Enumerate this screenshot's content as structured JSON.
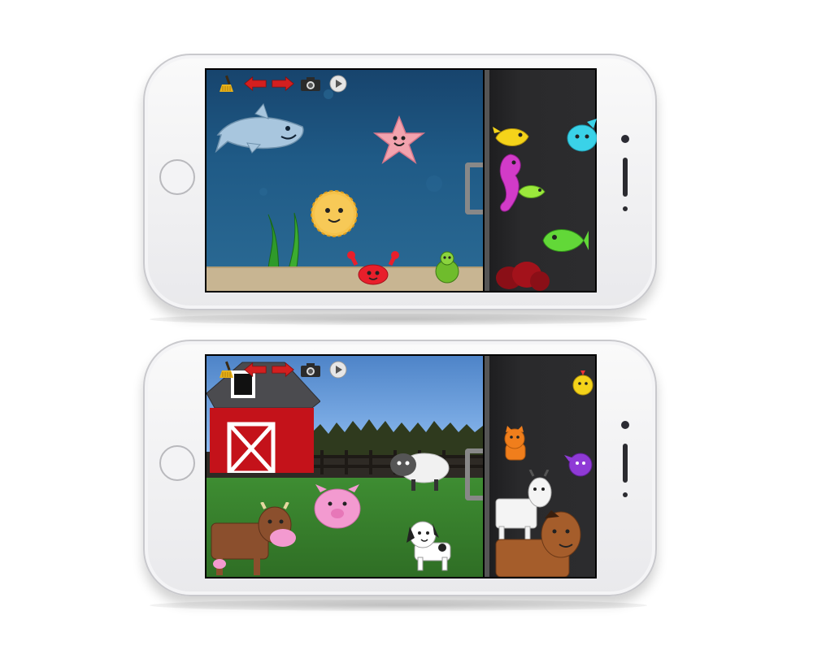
{
  "phones": [
    {
      "id": "ocean",
      "toolbar": {
        "clear_icon": "broom-icon",
        "back_icon": "arrow-left-icon",
        "forward_icon": "arrow-right-icon",
        "camera_icon": "camera-icon",
        "play_icon": "play-icon"
      },
      "scene_stickers": [
        "shark",
        "starfish",
        "pufferfish",
        "seaweed",
        "crab",
        "turtle"
      ],
      "tray_stickers": [
        "yellow-fish",
        "blue-fish",
        "seahorse",
        "green-fish",
        "green-fish-large",
        "coral"
      ]
    },
    {
      "id": "farm",
      "toolbar": {
        "clear_icon": "broom-icon",
        "back_icon": "arrow-left-icon",
        "forward_icon": "arrow-right-icon",
        "camera_icon": "camera-icon",
        "play_icon": "play-icon"
      },
      "scene_stickers": [
        "barn",
        "sheep",
        "pig",
        "cow",
        "dog"
      ],
      "tray_stickers": [
        "chick",
        "cat",
        "purple-bird",
        "goat",
        "horse"
      ]
    }
  ],
  "colors": {
    "arrow_red": "#d31f1f",
    "ocean_bg": "#1f5a86",
    "tray_bg": "#2a2a2c",
    "grass": "#3e8d32",
    "barn_red": "#c4121a"
  }
}
